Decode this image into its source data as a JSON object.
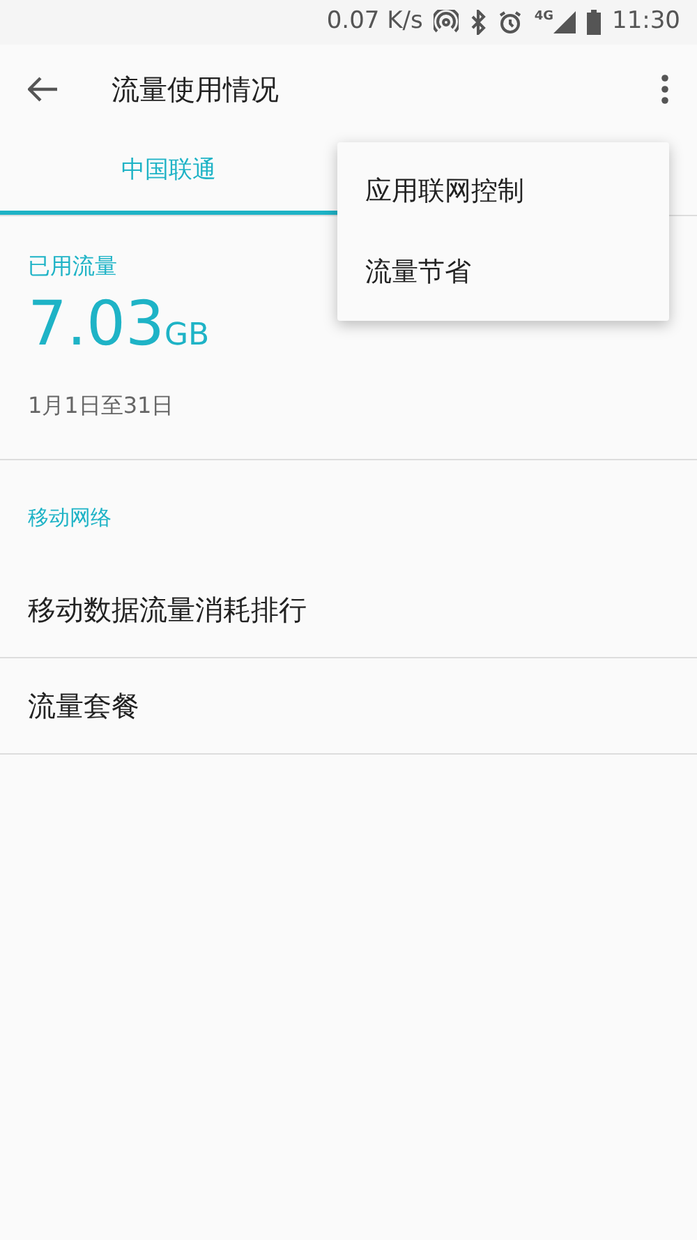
{
  "status_bar": {
    "speed": "0.07 K/s",
    "network": "4G",
    "time": "11:30"
  },
  "app_bar": {
    "title": "流量使用情况"
  },
  "tabs": [
    {
      "label": "中国联通",
      "selected": true
    }
  ],
  "usage": {
    "label": "已用流量",
    "amount": "7.03",
    "unit": "GB",
    "period": "1月1日至31日"
  },
  "section": {
    "title": "移动网络",
    "items": [
      "移动数据流量消耗排行",
      "流量套餐"
    ]
  },
  "menu": {
    "items": [
      "应用联网控制",
      "流量节省"
    ]
  }
}
